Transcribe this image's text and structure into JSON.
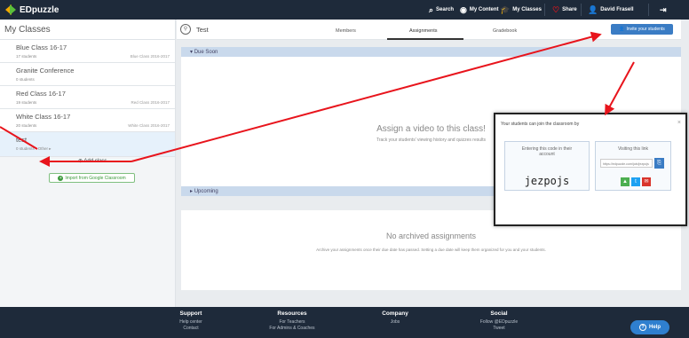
{
  "topbar": {
    "brand": "EDpuzzle",
    "search": "Search",
    "my_content": "My Content",
    "my_classes": "My Classes",
    "share": "Share",
    "user": "David Frasell"
  },
  "sidebar": {
    "title": "My Classes",
    "classes": [
      {
        "name": "Blue Class 16-17",
        "students": "17 students",
        "right": "Blue Class 2016-2017"
      },
      {
        "name": "Granite Conference",
        "students": "0 students",
        "right": ""
      },
      {
        "name": "Red Class 16-17",
        "students": "19 students",
        "right": "Red Class 2016-2017"
      },
      {
        "name": "White Class 16-17",
        "students": "20 students",
        "right": "White Class 2016-2017"
      },
      {
        "name": "test",
        "students": "0 students · Other ▸",
        "right": ""
      }
    ],
    "add_class": "Add class",
    "import_google": "Import from Google Classroom"
  },
  "main": {
    "class_title": "Test",
    "tabs": [
      "Members",
      "Assignments",
      "Gradebook"
    ],
    "invite_button": "Invite your students",
    "due_soon": "Due Soon",
    "assign_title": "Assign a video to this class!",
    "assign_sub": "Track your students' viewing history and quizzes results",
    "upcoming": "Upcoming",
    "archived_title": "No archived assignments",
    "archived_sub": "Archive your assignments once their due date has passed. Setting a due date will keep them organized for you and your students."
  },
  "popup": {
    "title": "Your students can join the classroom by",
    "close": "×",
    "code_label": "Entering this code in their account",
    "code": "jezpojs",
    "link_label": "Visiting this link",
    "link": "https://edpuzzle.com/join/jezpojs"
  },
  "footer": {
    "support": {
      "heading": "Support",
      "links": [
        "Help center",
        "Contact"
      ]
    },
    "resources": {
      "heading": "Resources",
      "links": [
        "For Teachers",
        "For Admins & Coaches"
      ]
    },
    "company": {
      "heading": "Company",
      "links": [
        "Jobs"
      ]
    },
    "social": {
      "heading": "Social",
      "links": [
        "Follow @EDpuzzle",
        "Tweet"
      ]
    },
    "help": "Help"
  },
  "colors": {
    "topbar": "#1e2a3a",
    "accent_blue": "#3a7cc4",
    "annotation_red": "#e8141c"
  },
  "icons": [
    "search-icon",
    "play-circle-icon",
    "graduation-cap-icon",
    "heart-icon",
    "user-icon",
    "logout-icon",
    "plus-circle-icon",
    "link-icon"
  ]
}
